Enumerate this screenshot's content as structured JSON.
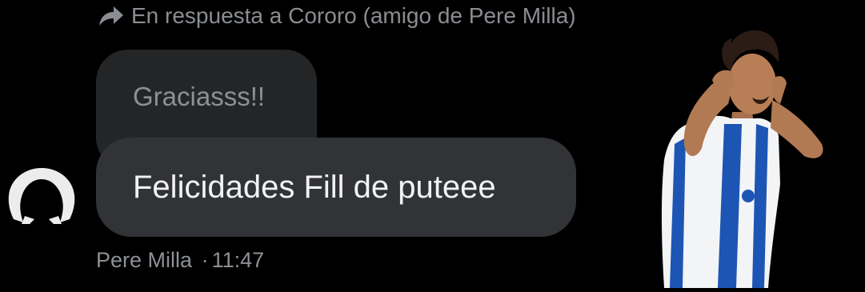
{
  "reply_header": {
    "icon": "reply-arrow-icon",
    "text": "En respuesta a Cororo (amigo de Pere Milla)"
  },
  "quoted_message": {
    "text": "Graciasss!!"
  },
  "message": {
    "text": "Felicidades Fill de puteee",
    "sender": "Pere Milla",
    "separator": "·",
    "time": "11:47"
  },
  "colors": {
    "background": "#000000",
    "bubble": "#323336",
    "quoted_bubble": "#242527",
    "secondary_text": "#8d9094",
    "primary_text": "#f1f2f3",
    "jersey_blue": "#1d55b4"
  }
}
